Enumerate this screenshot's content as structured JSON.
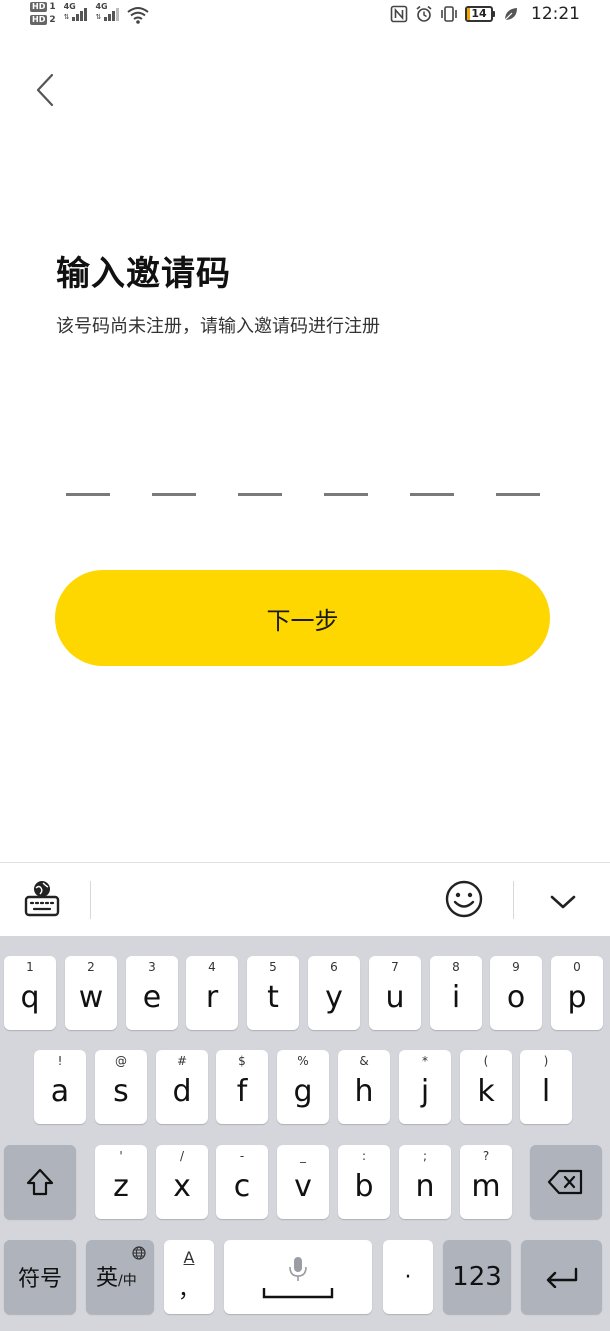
{
  "status_bar": {
    "sim1": "HD",
    "sim1_num": "1",
    "sim2": "HD",
    "sim2_num": "2",
    "net1": "4G",
    "net2": "4G",
    "battery_level": "14",
    "time": "12:21",
    "icons": [
      "nfc-icon",
      "alarm-icon",
      "vibrate-icon",
      "battery-icon",
      "leaf-icon"
    ]
  },
  "page": {
    "title": "输入邀请码",
    "subtitle": "该号码尚未注册，请输入邀请码进行注册",
    "code_length": 6,
    "next_label": "下一步",
    "accent_color": "#fed700"
  },
  "keyboard": {
    "row1": [
      {
        "main": "q",
        "sub": "1"
      },
      {
        "main": "w",
        "sub": "2"
      },
      {
        "main": "e",
        "sub": "3"
      },
      {
        "main": "r",
        "sub": "4"
      },
      {
        "main": "t",
        "sub": "5"
      },
      {
        "main": "y",
        "sub": "6"
      },
      {
        "main": "u",
        "sub": "7"
      },
      {
        "main": "i",
        "sub": "8"
      },
      {
        "main": "o",
        "sub": "9"
      },
      {
        "main": "p",
        "sub": "0"
      }
    ],
    "row2": [
      {
        "main": "a",
        "sub": "!"
      },
      {
        "main": "s",
        "sub": "@"
      },
      {
        "main": "d",
        "sub": "#"
      },
      {
        "main": "f",
        "sub": "$"
      },
      {
        "main": "g",
        "sub": "%"
      },
      {
        "main": "h",
        "sub": "&"
      },
      {
        "main": "j",
        "sub": "*"
      },
      {
        "main": "k",
        "sub": "("
      },
      {
        "main": "l",
        "sub": ")"
      }
    ],
    "row3": [
      {
        "main": "z",
        "sub": "'"
      },
      {
        "main": "x",
        "sub": "/"
      },
      {
        "main": "c",
        "sub": "-"
      },
      {
        "main": "v",
        "sub": "_"
      },
      {
        "main": "b",
        "sub": ":"
      },
      {
        "main": "n",
        "sub": ";"
      },
      {
        "main": "m",
        "sub": "?"
      }
    ],
    "symbols_label": "符号",
    "lang_label": "英",
    "lang_sub": "中",
    "punct_top": "A",
    "punct_bottom": "，",
    "period_label": "·",
    "numbers_label": "123"
  }
}
